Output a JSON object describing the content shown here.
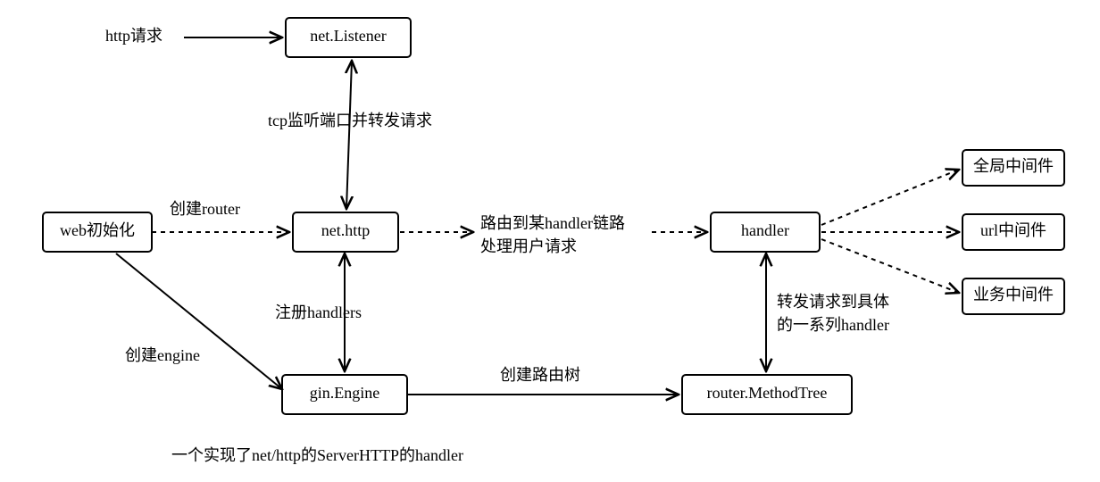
{
  "nodes": {
    "web_init": "web初始化",
    "net_listener": "net.Listener",
    "net_http": "net.http",
    "gin_engine": "gin.Engine",
    "handler": "handler",
    "router_method_tree": "router.MethodTree",
    "mw_global": "全局中间件",
    "mw_url": "url中间件",
    "mw_biz": "业务中间件"
  },
  "labels": {
    "http_request": "http请求",
    "create_router": "创建router",
    "create_engine": "创建engine",
    "tcp_listen": "tcp监听端口并转发请求",
    "register_handlers": "注册handlers",
    "route_to_handler_1": "路由到某handler链路",
    "route_to_handler_2": "处理用户请求",
    "create_route_tree": "创建路由树",
    "forward_to_handlers_1": "转发请求到具体",
    "forward_to_handlers_2": "的一系列handler",
    "footer_note": "一个实现了net/http的ServerHTTP的handler"
  }
}
